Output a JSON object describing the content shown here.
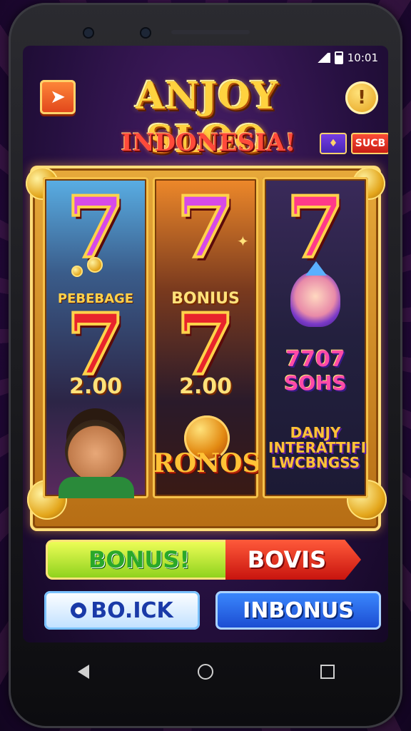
{
  "status_bar": {
    "time": "10:01"
  },
  "header": {
    "title": "ANJOY SLOO",
    "subtitle": "INDONESIA!",
    "back_icon": "back-arrow-icon",
    "info_icon": "info-icon",
    "badge_right": "SUCB"
  },
  "reels": {
    "reel1": {
      "mid_label": "PEBEBAGE",
      "mid_amount": "2.00"
    },
    "reel2": {
      "mid_label": "BONIUS",
      "mid_amount": "2.00",
      "bottom_label": "RONOSS"
    },
    "reel3": {
      "mid_label": "7707",
      "mid_sub": "SOHS",
      "bottom_label": "DANJY INTERATTIFI LWCBNGSS"
    }
  },
  "bonus_bar": {
    "left_label": "BONUS!",
    "right_label": "BOVIS"
  },
  "buttons": {
    "back_label": "BO.ICK",
    "inbonus_label": "INBONUS"
  },
  "colors": {
    "gold": "#ffd23f",
    "red": "#e8242c",
    "green": "#8ad01a",
    "blue": "#1a4ad0"
  }
}
